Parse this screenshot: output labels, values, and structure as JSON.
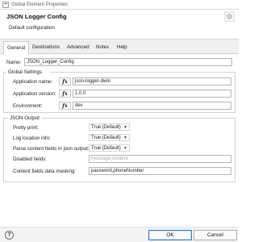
{
  "window": {
    "title": "Global Element Properties"
  },
  "header": {
    "title": "JSON Logger Config",
    "subtitle": "Default configuration"
  },
  "tabs": [
    {
      "label": "General",
      "active": true
    },
    {
      "label": "Destinations",
      "active": false
    },
    {
      "label": "Advanced",
      "active": false
    },
    {
      "label": "Notes",
      "active": false
    },
    {
      "label": "Help",
      "active": false
    }
  ],
  "general": {
    "name_label": "Name:",
    "name_value": "JSON_Logger_Config"
  },
  "global_settings": {
    "title": "Global Settings",
    "app_name_label": "Application name:",
    "app_name_value": "json-logger-dwin",
    "app_version_label": "Application version:",
    "app_version_value": "1.0.0",
    "environment_label": "Environment:",
    "environment_value": "dev",
    "fx": "fx"
  },
  "json_output": {
    "title": "JSON Output",
    "pretty_print_label": "Pretty print:",
    "pretty_print_value": "True (Default)",
    "log_location_label": "Log location info:",
    "log_location_value": "True (Default)",
    "parse_content_label": "Parse content fields in json output:",
    "parse_content_value": "True (Default)",
    "disabled_fields_label": "Disabled fields:",
    "disabled_fields_placeholder": "message,content",
    "masking_label": "Content fields data masking:",
    "masking_value": "password,phoneNumber"
  },
  "footer": {
    "help": "?",
    "ok": "OK",
    "cancel": "Cancel"
  }
}
